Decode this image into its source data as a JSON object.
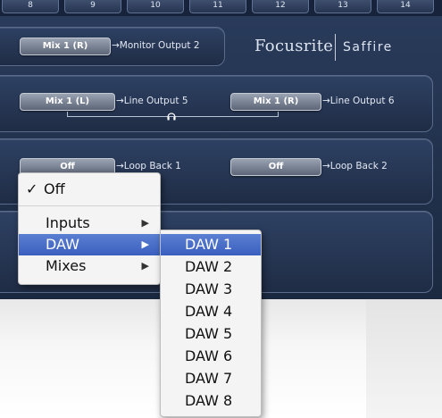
{
  "channel_strip": {
    "numbers": [
      "8",
      "9",
      "10",
      "11",
      "12",
      "13",
      "14"
    ]
  },
  "branding": {
    "brand": "Focusrite",
    "product": "Saffire"
  },
  "panel1": {
    "pill": "Mix 1 (R)",
    "route": "→Monitor Output 2"
  },
  "panel2": {
    "left_pill": "Mix 1 (L)",
    "left_route": "→Line Output 5",
    "right_pill": "Mix 1 (R)",
    "right_route": "→Line Output 6",
    "link_icon": "headphones-icon"
  },
  "panel3": {
    "left_pill": "Off",
    "left_route": "→Loop Back 1",
    "right_pill": "Off",
    "right_route": "→Loop Back 2"
  },
  "menu": {
    "checkmark": "✓",
    "items": [
      {
        "label": "Off",
        "checked": true
      },
      {
        "label": "Inputs",
        "submenu": true
      },
      {
        "label": "DAW",
        "submenu": true,
        "selected": true
      },
      {
        "label": "Mixes",
        "submenu": true
      }
    ],
    "arrow_glyph": "▶"
  },
  "submenu": {
    "items": [
      "DAW 1",
      "DAW 2",
      "DAW 3",
      "DAW 4",
      "DAW 5",
      "DAW 6",
      "DAW 7",
      "DAW 8"
    ],
    "selected_index": 0
  },
  "colors": {
    "app_background": "#22324f",
    "highlight": "#4a6fc8",
    "menu_background": "#f4f4f4"
  }
}
